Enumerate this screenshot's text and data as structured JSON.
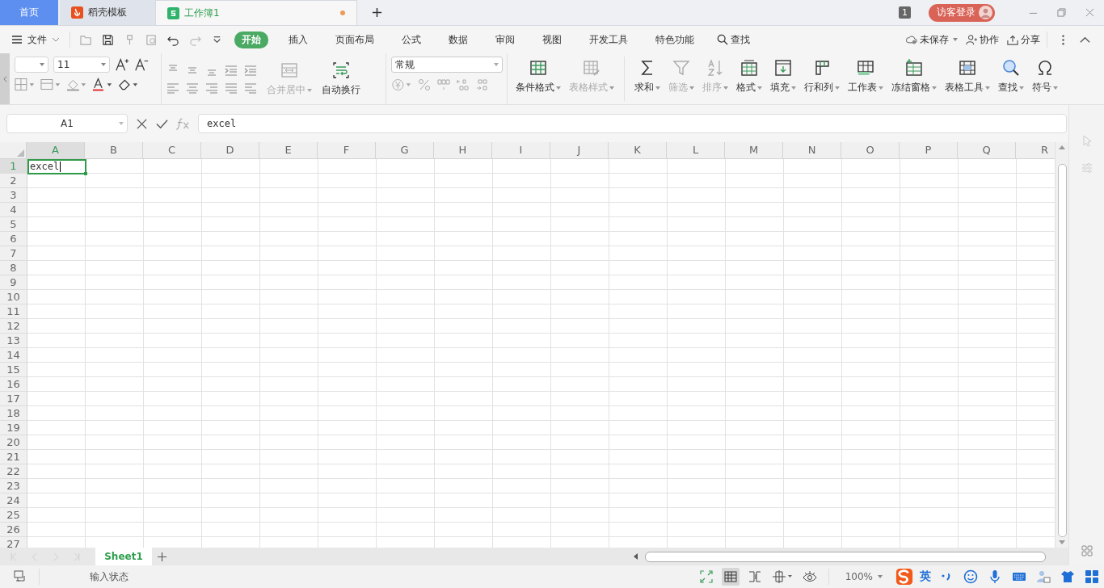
{
  "tabs": [
    {
      "label": "首页",
      "kind": "home",
      "selected": false
    },
    {
      "label": "稻壳模板",
      "kind": "docer",
      "selected": false
    },
    {
      "label": "工作簿1",
      "kind": "sheet",
      "selected": true,
      "modified": true
    }
  ],
  "window_badge": "1",
  "login_button": "访客登录",
  "file_menu": "文件",
  "menu": [
    {
      "label": "开始",
      "selected": true
    },
    {
      "label": "插入",
      "selected": false
    },
    {
      "label": "页面布局",
      "selected": false
    },
    {
      "label": "公式",
      "selected": false
    },
    {
      "label": "数据",
      "selected": false
    },
    {
      "label": "审阅",
      "selected": false
    },
    {
      "label": "视图",
      "selected": false
    },
    {
      "label": "开发工具",
      "selected": false
    },
    {
      "label": "特色功能",
      "selected": false
    }
  ],
  "search_menu": "查找",
  "right_actions": [
    "未保存",
    "协作",
    "分享"
  ],
  "font_size": "11",
  "merge_button": {
    "label": "合并居中",
    "disabled": true
  },
  "wrap_button": {
    "label": "自动换行",
    "disabled": false
  },
  "number_format": "常规",
  "ribbon_buttons": [
    {
      "label": "条件格式",
      "disabled": false
    },
    {
      "label": "表格样式",
      "disabled": true
    },
    {
      "label": "求和",
      "disabled": false
    },
    {
      "label": "筛选",
      "disabled": true
    },
    {
      "label": "排序",
      "disabled": true
    },
    {
      "label": "格式",
      "disabled": false
    },
    {
      "label": "填充",
      "disabled": false
    },
    {
      "label": "行和列",
      "disabled": false
    },
    {
      "label": "工作表",
      "disabled": false
    },
    {
      "label": "冻结窗格",
      "disabled": false
    },
    {
      "label": "表格工具",
      "disabled": false
    },
    {
      "label": "查找",
      "disabled": false
    },
    {
      "label": "符号",
      "disabled": false
    }
  ],
  "name_box": "A1",
  "formula": "excel",
  "columns": [
    {
      "label": "A",
      "selected": true
    },
    {
      "label": "B",
      "selected": false
    },
    {
      "label": "C",
      "selected": false
    },
    {
      "label": "D",
      "selected": false
    },
    {
      "label": "E",
      "selected": false
    },
    {
      "label": "F",
      "selected": false
    },
    {
      "label": "G",
      "selected": false
    },
    {
      "label": "H",
      "selected": false
    },
    {
      "label": "I",
      "selected": false
    },
    {
      "label": "J",
      "selected": false
    },
    {
      "label": "K",
      "selected": false
    },
    {
      "label": "L",
      "selected": false
    },
    {
      "label": "M",
      "selected": false
    },
    {
      "label": "N",
      "selected": false
    },
    {
      "label": "O",
      "selected": false
    },
    {
      "label": "P",
      "selected": false
    },
    {
      "label": "Q",
      "selected": false
    },
    {
      "label": "R",
      "selected": false
    }
  ],
  "rows": [
    {
      "label": "1",
      "selected": true
    },
    {
      "label": "2",
      "selected": false
    },
    {
      "label": "3",
      "selected": false
    },
    {
      "label": "4",
      "selected": false
    },
    {
      "label": "5",
      "selected": false
    },
    {
      "label": "6",
      "selected": false
    },
    {
      "label": "7",
      "selected": false
    },
    {
      "label": "8",
      "selected": false
    },
    {
      "label": "9",
      "selected": false
    },
    {
      "label": "10",
      "selected": false
    },
    {
      "label": "11",
      "selected": false
    },
    {
      "label": "12",
      "selected": false
    },
    {
      "label": "13",
      "selected": false
    },
    {
      "label": "14",
      "selected": false
    },
    {
      "label": "15",
      "selected": false
    },
    {
      "label": "16",
      "selected": false
    },
    {
      "label": "17",
      "selected": false
    },
    {
      "label": "18",
      "selected": false
    },
    {
      "label": "19",
      "selected": false
    },
    {
      "label": "20",
      "selected": false
    },
    {
      "label": "21",
      "selected": false
    },
    {
      "label": "22",
      "selected": false
    },
    {
      "label": "23",
      "selected": false
    },
    {
      "label": "24",
      "selected": false
    },
    {
      "label": "25",
      "selected": false
    },
    {
      "label": "26",
      "selected": false
    },
    {
      "label": "27",
      "selected": false
    }
  ],
  "active_cell": {
    "value": "excel"
  },
  "sheet_tabs": [
    {
      "label": "Sheet1",
      "selected": true
    }
  ],
  "status": "输入状态",
  "zoom": "100%",
  "ime": "英"
}
